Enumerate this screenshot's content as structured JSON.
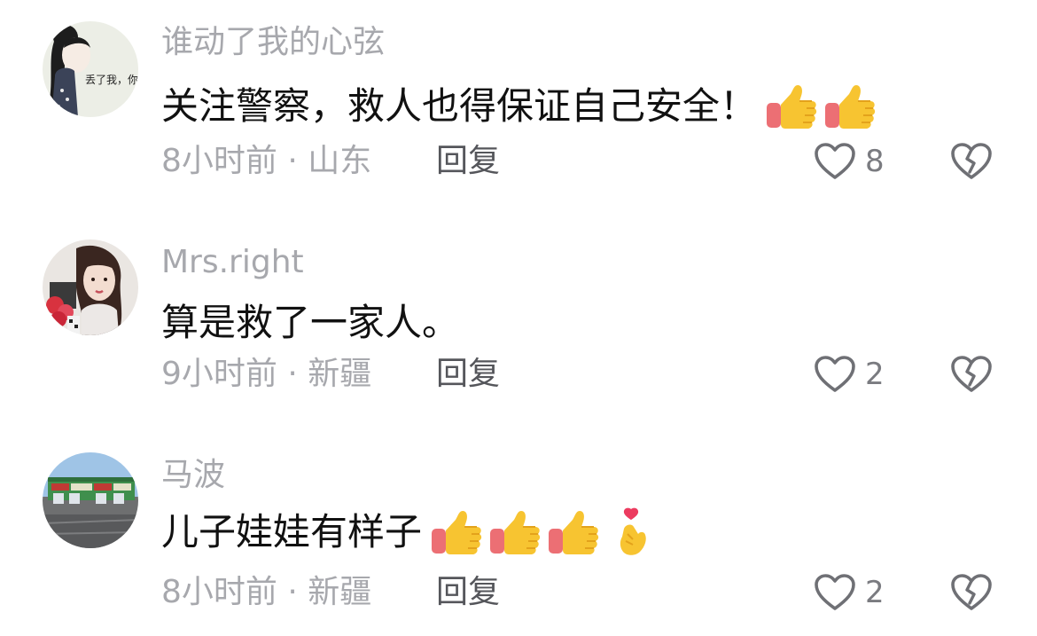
{
  "comments": [
    {
      "username": "谁动了我的心弦",
      "text": "关注警察，救人也得保证自己安全！",
      "emojis": [
        "thumbs-up-icon",
        "thumbs-up-icon"
      ],
      "time": "8小时前",
      "location": "山东",
      "meta": "8小时前 · 山东",
      "reply_label": "回复",
      "likes": "8",
      "avatar_text": "丢了我，你心会"
    },
    {
      "username": "Mrs.right",
      "text": "算是救了一家人。",
      "emojis": [],
      "time": "9小时前",
      "location": "新疆",
      "meta": "9小时前 · 新疆",
      "reply_label": "回复",
      "likes": "2"
    },
    {
      "username": "马波",
      "text": "儿子娃娃有样子",
      "emojis": [
        "thumbs-up-icon",
        "thumbs-up-icon",
        "thumbs-up-icon",
        "finger-heart-icon"
      ],
      "time": "8小时前",
      "location": "新疆",
      "meta": "8小时前 · 新疆",
      "reply_label": "回复",
      "likes": "2"
    }
  ],
  "colors": {
    "username": "#a7a8ad",
    "text": "#111111",
    "reply": "#55565b",
    "icon": "#6f7075"
  }
}
